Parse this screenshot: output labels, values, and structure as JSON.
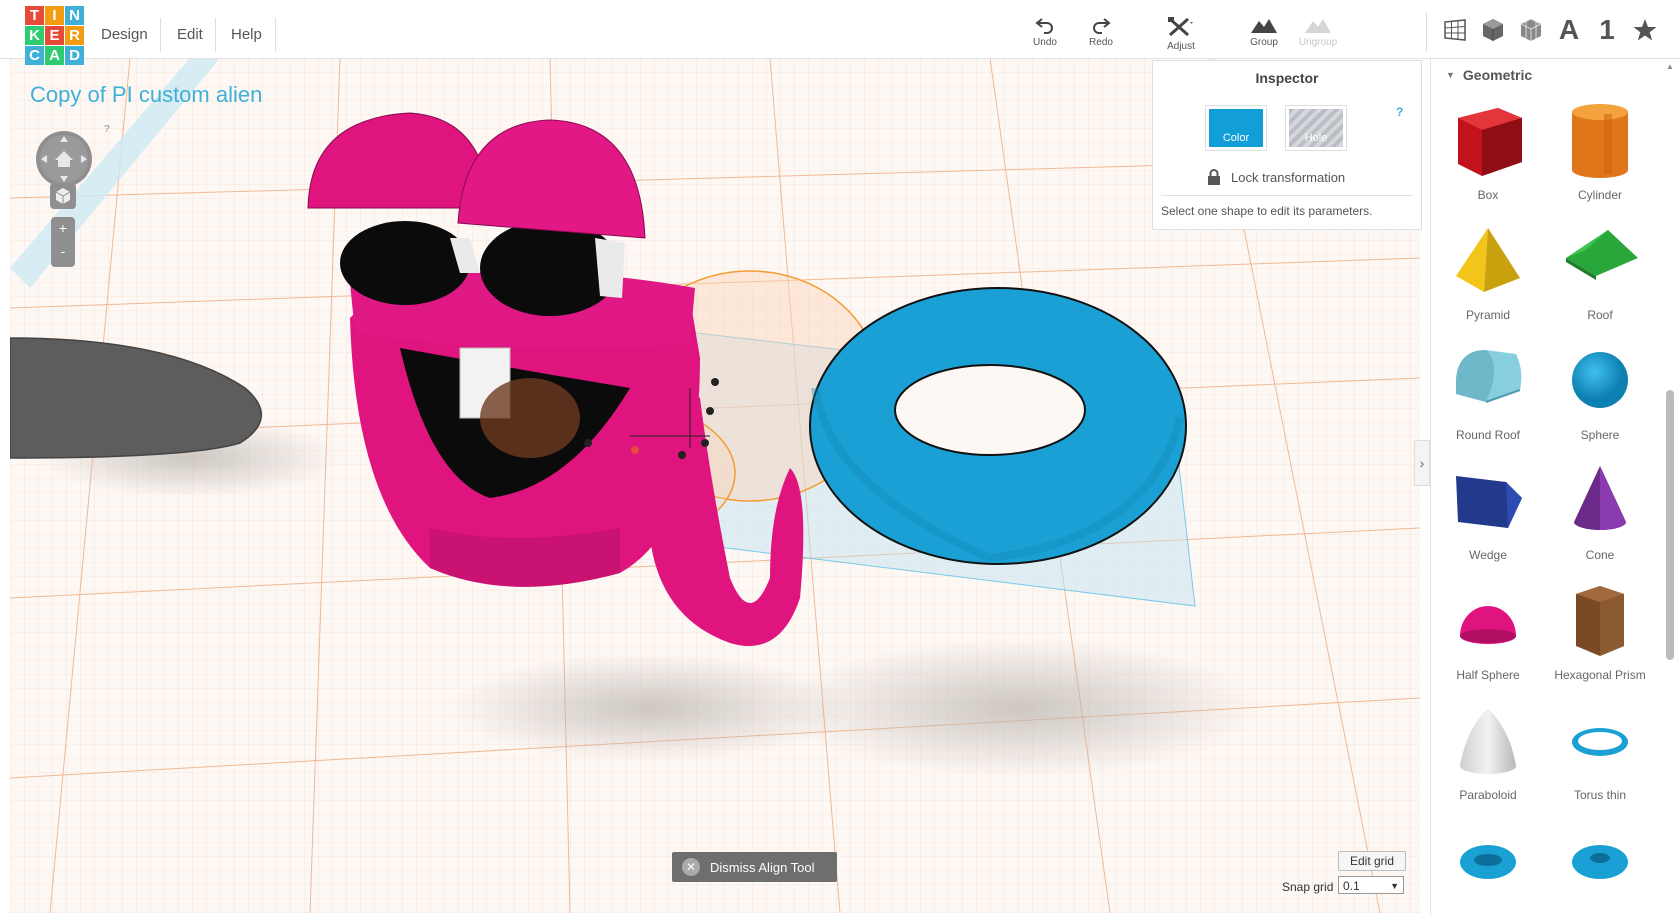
{
  "app": {
    "logo_letters": [
      "T",
      "I",
      "N",
      "K",
      "E",
      "R",
      "C",
      "A",
      "D"
    ],
    "logo_colors": [
      "#e64b3a",
      "#f39c12",
      "#3fb0d8",
      "#2ecc71",
      "#e64b3a",
      "#f39c12",
      "#3fb0d8",
      "#2ecc71",
      "#3fb0d8"
    ]
  },
  "menu": {
    "items": [
      "Design",
      "Edit",
      "Help"
    ]
  },
  "toolbar": {
    "undo": "Undo",
    "redo": "Redo",
    "adjust": "Adjust",
    "group": "Group",
    "ungroup": "Ungroup"
  },
  "view_icons": [
    "grid-view-icon",
    "cube-view-icon",
    "wireframe-view-icon",
    "text-icon",
    "number-icon",
    "star-icon"
  ],
  "view_labels": {
    "text": "A",
    "number": "1"
  },
  "design": {
    "title": "Copy of PI custom alien"
  },
  "nav": {
    "help": "?",
    "zoom_in": "+",
    "zoom_out": "-"
  },
  "inspector": {
    "title": "Inspector",
    "color_label": "Color",
    "hole_label": "Hole",
    "help": "?",
    "lock_label": "Lock transformation",
    "message": "Select one shape to edit its parameters.",
    "color_swatch": "#129fd8"
  },
  "sidebar": {
    "category": "Geometric",
    "shapes": [
      {
        "label": "Box",
        "icon": "box-shape-icon"
      },
      {
        "label": "Cylinder",
        "icon": "cylinder-shape-icon"
      },
      {
        "label": "Pyramid",
        "icon": "pyramid-shape-icon"
      },
      {
        "label": "Roof",
        "icon": "roof-shape-icon"
      },
      {
        "label": "Round Roof",
        "icon": "round-roof-shape-icon"
      },
      {
        "label": "Sphere",
        "icon": "sphere-shape-icon"
      },
      {
        "label": "Wedge",
        "icon": "wedge-shape-icon"
      },
      {
        "label": "Cone",
        "icon": "cone-shape-icon"
      },
      {
        "label": "Half Sphere",
        "icon": "half-sphere-shape-icon"
      },
      {
        "label": "Hexagonal Prism",
        "icon": "hexagonal-prism-shape-icon"
      },
      {
        "label": "Paraboloid",
        "icon": "paraboloid-shape-icon"
      },
      {
        "label": "Torus thin",
        "icon": "torus-thin-shape-icon"
      },
      {
        "label": "",
        "icon": "torus-shape-icon"
      },
      {
        "label": "",
        "icon": "tube-shape-icon"
      }
    ]
  },
  "bottom": {
    "dismiss": "Dismiss Align Tool",
    "edit_grid": "Edit grid",
    "snap_label": "Snap grid",
    "snap_value": "0.1"
  },
  "colors": {
    "accent": "#3fb0d8",
    "magenta": "#e0147f",
    "torus": "#1aa0d4"
  }
}
